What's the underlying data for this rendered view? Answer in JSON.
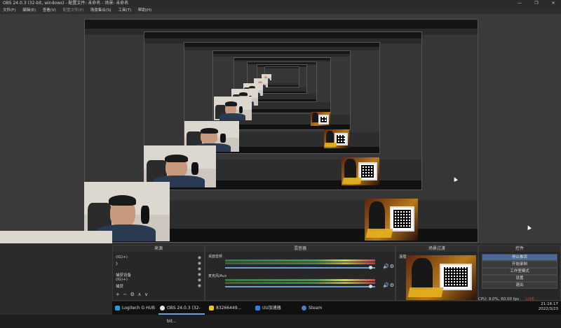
{
  "window": {
    "title": "OBS 24.0.3 (32-bit, windows) - 配置文件: 未命名 - 场景: 未命名",
    "controls": [
      "—",
      "❐",
      "✕"
    ]
  },
  "menubar": {
    "items": [
      "文件(F)",
      "编辑(E)",
      "查看(V)",
      "配置文件(P)",
      "场景集合(S)",
      "工具(T)",
      "帮助(H)"
    ]
  },
  "docks": {
    "sources": {
      "title": "来源",
      "items": [
        "(IG)+)",
        "》",
        "",
        "捕获设备",
        "(IG)+)",
        "捕获"
      ],
      "buttons": [
        "+",
        "−",
        "⚙",
        "∧",
        "∨"
      ]
    },
    "mixer": {
      "title": "混音器",
      "tracks": [
        {
          "label": "桌面音频",
          "level": 0.72
        },
        {
          "label": "麦克风/Aux",
          "level": 0.74
        }
      ]
    },
    "transitions": {
      "title": "场景过渡",
      "mode": "渐隐"
    },
    "controls": {
      "title": "控件",
      "buttons": [
        "停止推流",
        "开始录制",
        "工作室模式",
        "设置",
        "退出"
      ]
    }
  },
  "statusbar": {
    "cpu": "CPU: 9.0%, 60.00 fps",
    "live": "LIVE"
  },
  "taskbar": {
    "items": [
      {
        "label": "Logitech G HUB",
        "color": "#1f9ed8"
      },
      {
        "label": "OBS 24.0.3 (32-bit...",
        "color": "#e6e6e6"
      },
      {
        "label": "83266449...",
        "color": "#f0c419"
      },
      {
        "label": "UU加速器",
        "color": "#2f7ee8"
      },
      {
        "label": "Steam",
        "color": "#4b80c9"
      }
    ],
    "time": "21:16:17",
    "date": "2022/3/23"
  },
  "colors": {
    "accent": "#6ea0d8",
    "meter_green": "#43a047",
    "meter_red": "#e53935"
  }
}
